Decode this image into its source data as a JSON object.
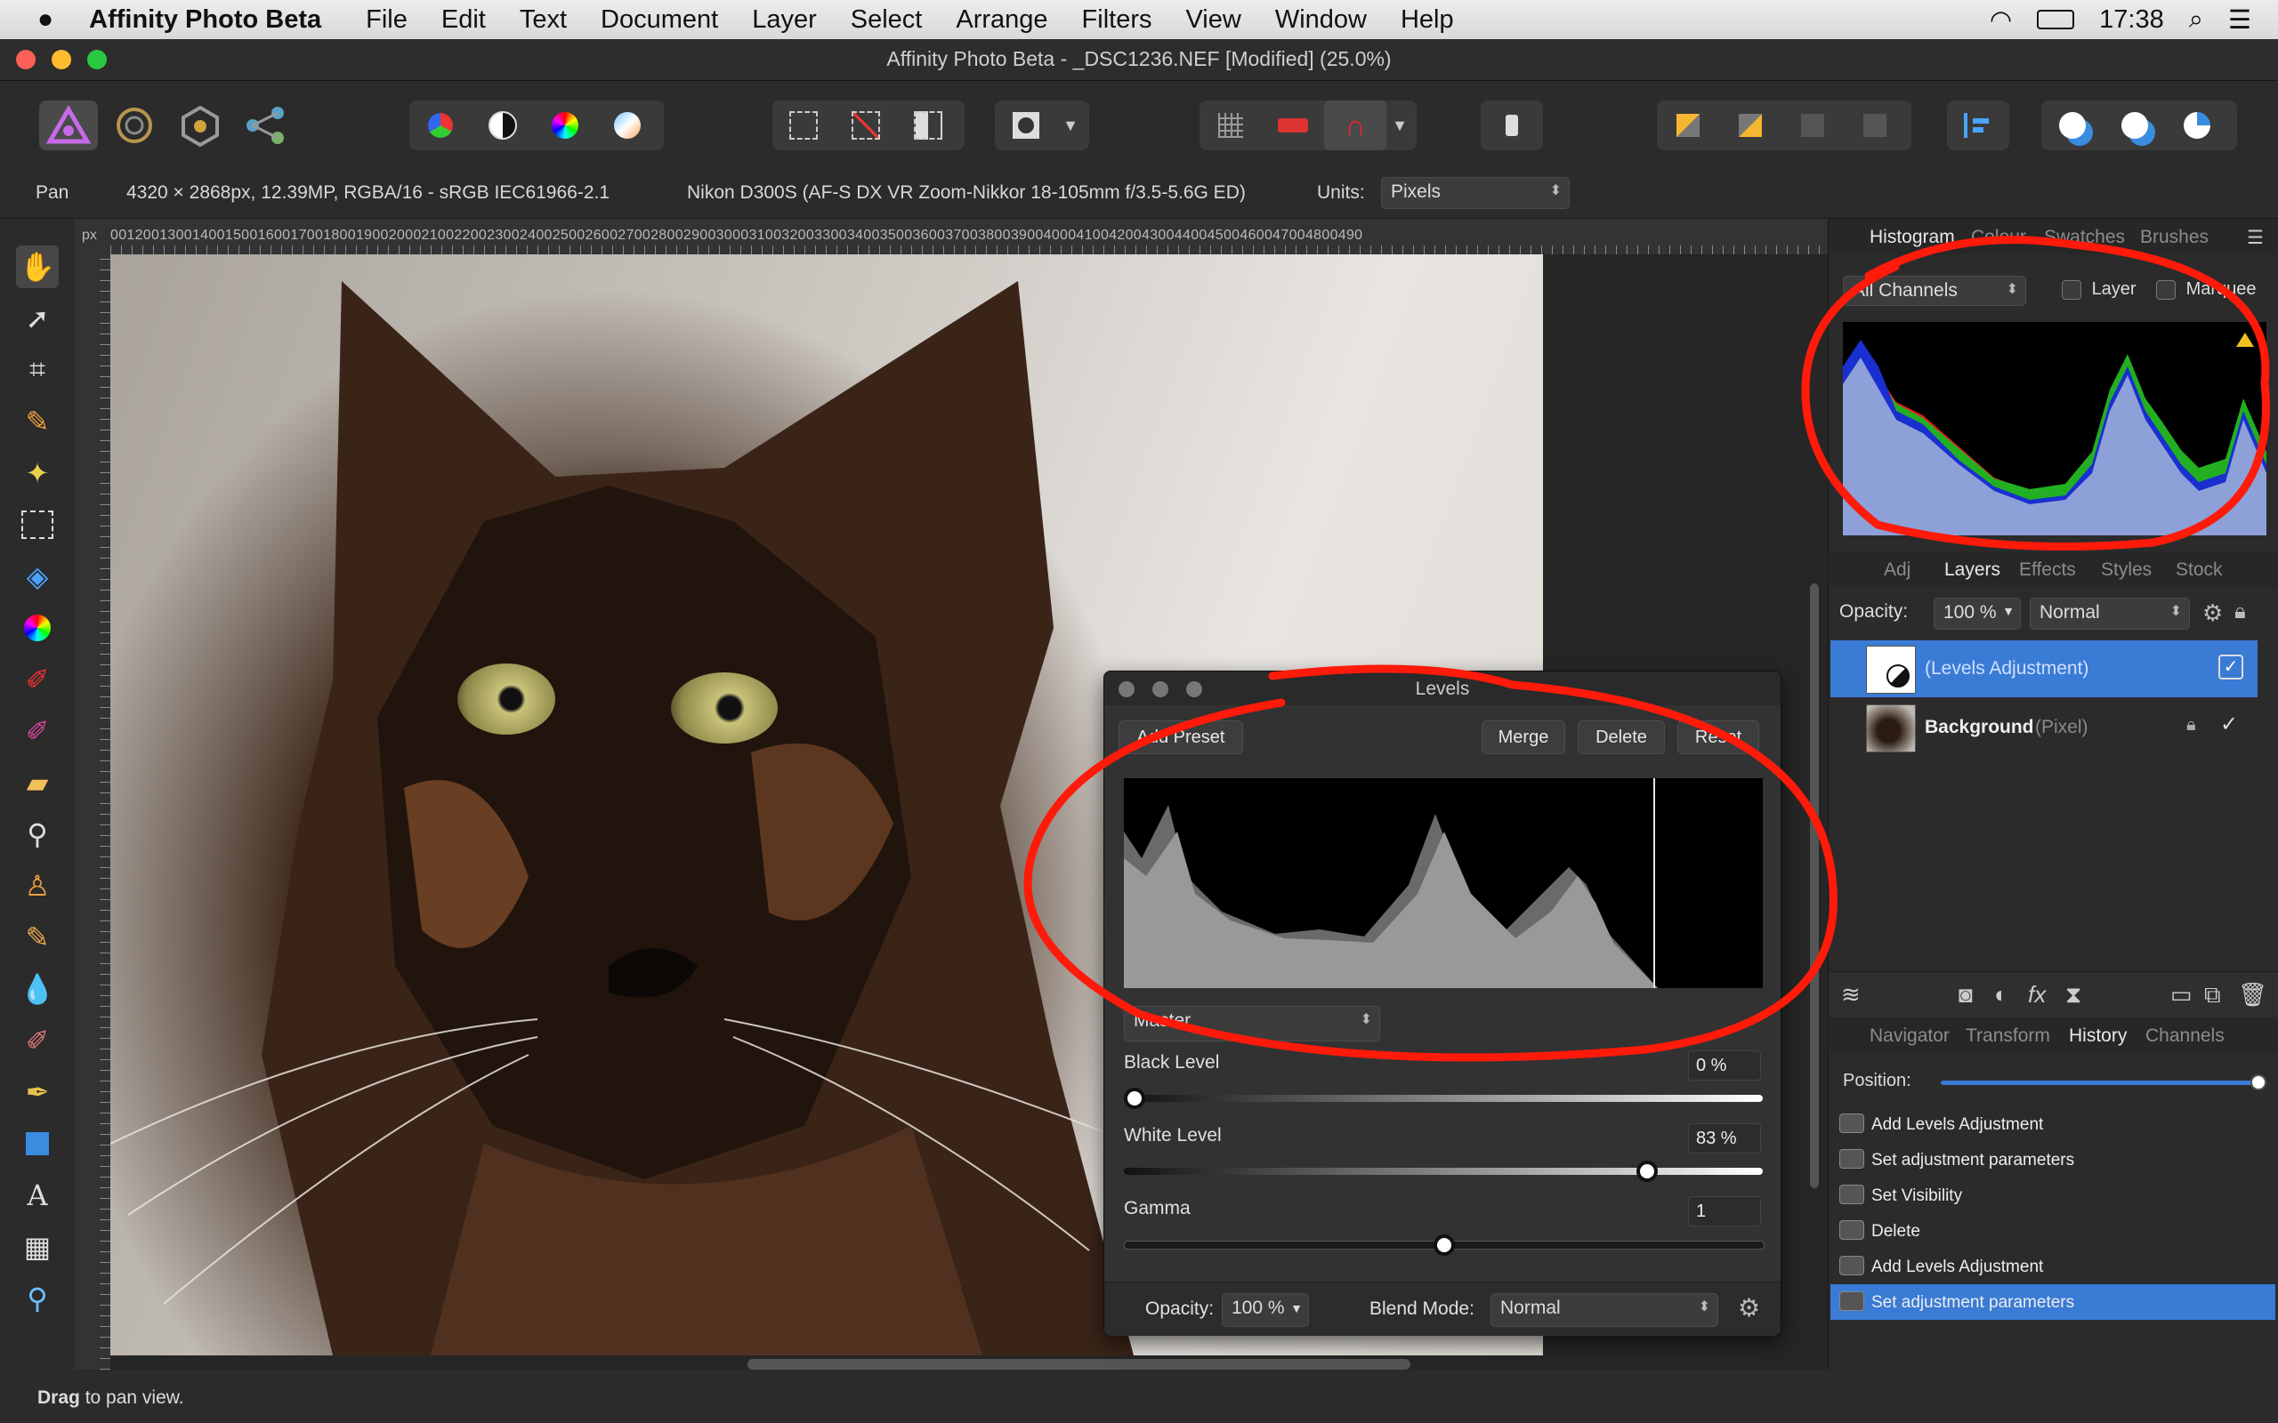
{
  "menubar": {
    "apple": "",
    "app_name": "Affinity Photo Beta",
    "items": [
      "File",
      "Edit",
      "Text",
      "Document",
      "Layer",
      "Select",
      "Arrange",
      "Filters",
      "View",
      "Window",
      "Help"
    ],
    "clock": "17:38"
  },
  "window": {
    "title": "Affinity Photo Beta - _DSC1236.NEF [Modified] (25.0%)"
  },
  "contextbar": {
    "tool": "Pan",
    "image_info": "4320 × 2868px, 12.39MP, RGBA/16 - sRGB IEC61966-2.1",
    "camera": "Nikon D300S (AF-S DX VR Zoom-Nikkor 18-105mm f/3.5-5.6G ED)",
    "units_label": "Units:",
    "units_value": "Pixels"
  },
  "ruler": {
    "unit": "px",
    "labels": "001200130014001500160017001800190020002100220023002400250026002700280029003000310032003300340035003600370038003900400041004200430044004500460047004800490"
  },
  "histogram_panel": {
    "tabs": [
      "Histogram",
      "Colour",
      "Swatches",
      "Brushes"
    ],
    "active_tab": "Histogram",
    "channel": "All Channels",
    "layer_label": "Layer",
    "marquee_label": "Marquee"
  },
  "layers_panel": {
    "tabs": [
      "Adj",
      "Layers",
      "Effects",
      "Styles",
      "Stock"
    ],
    "active_tab": "Layers",
    "opacity_label": "Opacity:",
    "opacity_value": "100 %",
    "blend_mode": "Normal",
    "layers": [
      {
        "name": "(Levels Adjustment)",
        "type": "",
        "selected": true
      },
      {
        "name": "Background",
        "type": "(Pixel)",
        "selected": false
      }
    ]
  },
  "history_panel": {
    "tabs": [
      "Navigator",
      "Transform",
      "History",
      "Channels"
    ],
    "active_tab": "History",
    "position_label": "Position:",
    "position_value": 1.0,
    "items": [
      "Add Levels Adjustment",
      "Set adjustment parameters",
      "Set Visibility",
      "Delete",
      "Add Levels Adjustment",
      "Set adjustment parameters"
    ],
    "selected_index": 5
  },
  "levels_dialog": {
    "title": "Levels",
    "add_preset": "Add Preset",
    "merge": "Merge",
    "delete": "Delete",
    "reset": "Reset",
    "channel": "Master",
    "black_level_label": "Black Level",
    "black_level_value": "0 %",
    "black_level_fraction": 0.0,
    "white_level_label": "White Level",
    "white_level_value": "83 %",
    "white_level_fraction": 0.83,
    "gamma_label": "Gamma",
    "gamma_value": "1",
    "gamma_fraction": 0.5,
    "opacity_label": "Opacity:",
    "opacity_value": "100 %",
    "blend_mode_label": "Blend Mode:",
    "blend_mode_value": "Normal"
  },
  "status": {
    "bold": "Drag",
    "rest": " to pan view."
  },
  "colors": {
    "accent": "#3a7bd5",
    "annotation": "#ff1a0a",
    "panel": "#2b2b2b"
  },
  "icons": [
    "apple-icon",
    "wifi-icon",
    "battery-icon",
    "search-icon",
    "list-icon",
    "hand-icon",
    "move-icon",
    "crop-icon",
    "brush-icon",
    "wand-icon",
    "marquee-icon",
    "fill-icon",
    "color-wheel-icon",
    "paint-icon",
    "eraser-icon",
    "zoom-icon",
    "stamp-icon",
    "dropper-icon",
    "pen-icon",
    "shape-icon",
    "text-icon",
    "mesh-icon",
    "gear-icon",
    "lock-icon",
    "checkmark-icon",
    "trash-icon",
    "fx-icon"
  ]
}
